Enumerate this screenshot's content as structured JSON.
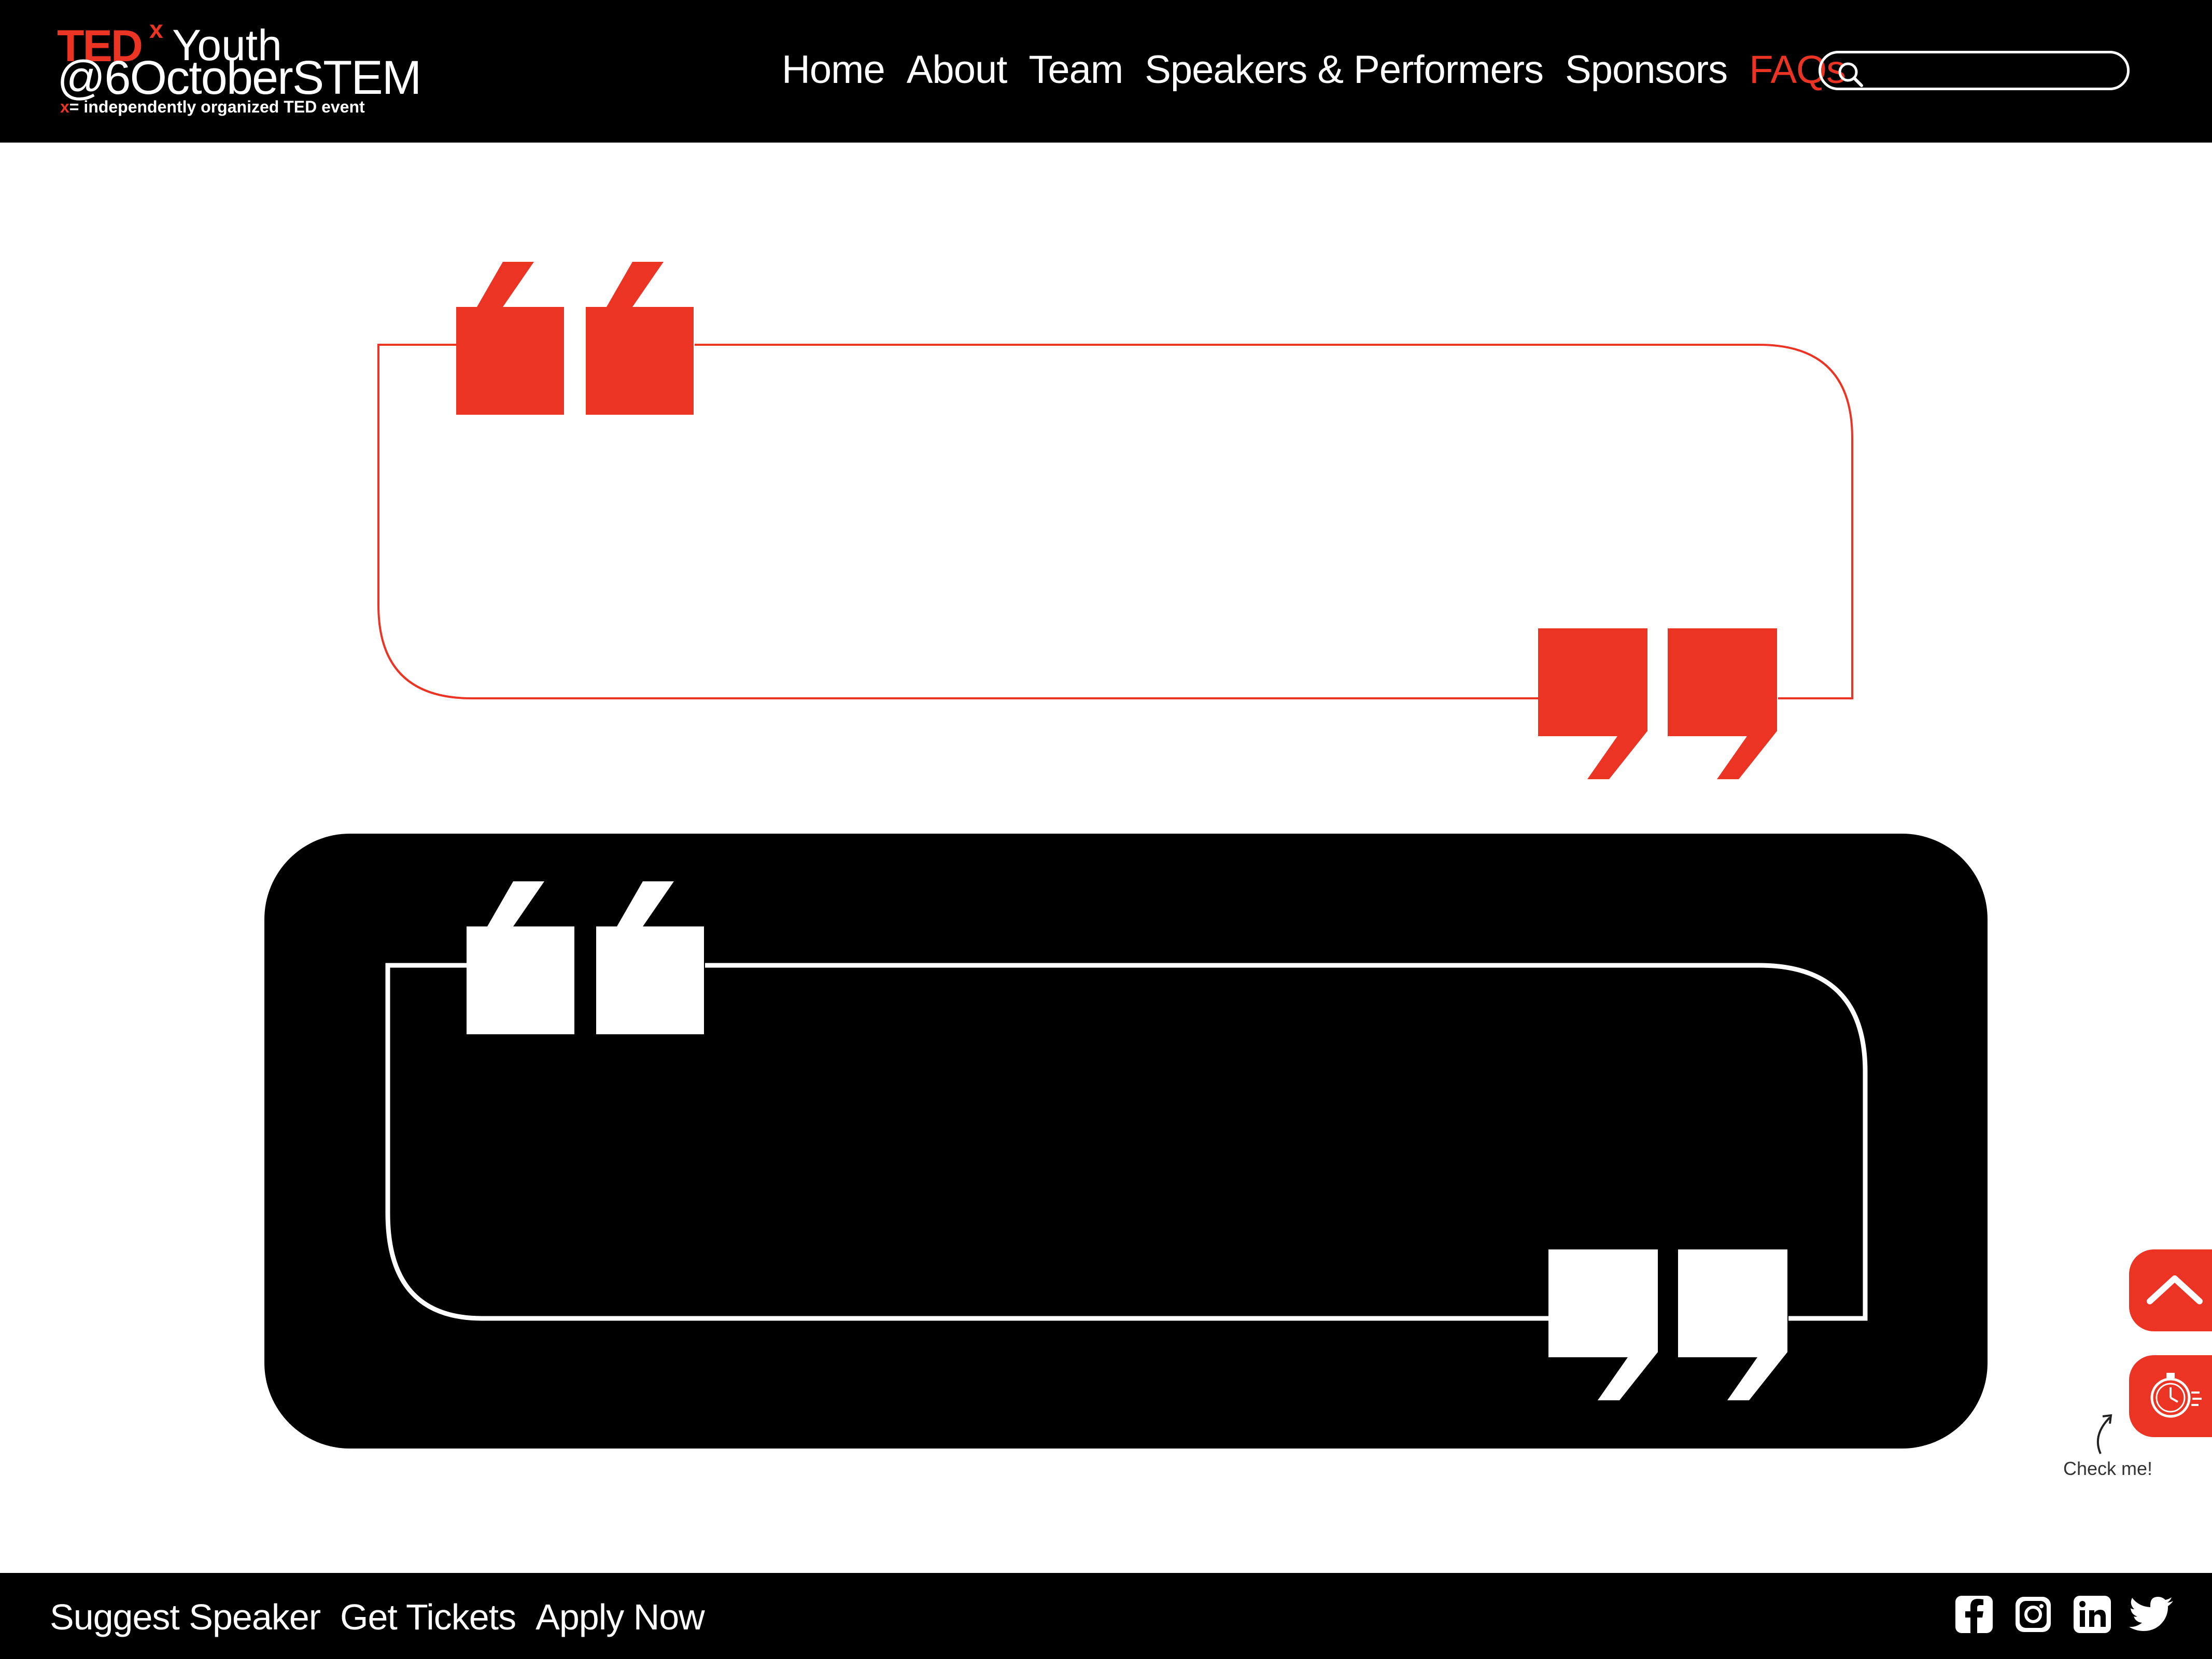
{
  "brand": {
    "ted": "TED",
    "x": "x",
    "youth": "Youth",
    "event_name": "@6OctoberSTEM",
    "tagline_x": "x",
    "tagline": "= independently organized TED event"
  },
  "nav": {
    "items": [
      {
        "label": "Home"
      },
      {
        "label": "About"
      },
      {
        "label": "Team"
      },
      {
        "label": "Speakers & Performers"
      },
      {
        "label": "Sponsors"
      },
      {
        "label": "FAQs",
        "active": true
      }
    ]
  },
  "search": {
    "placeholder": "",
    "icon": "search-icon"
  },
  "floating": {
    "up_icon": "chevron-up-icon",
    "timer_icon": "stopwatch-icon",
    "check_label": "Check me!"
  },
  "footer": {
    "links": [
      {
        "label": "Suggest Speaker"
      },
      {
        "label": "Get Tickets"
      },
      {
        "label": "Apply Now"
      }
    ],
    "social": [
      "facebook-icon",
      "instagram-icon",
      "linkedin-icon",
      "twitter-icon"
    ]
  },
  "colors": {
    "accent": "#eb3424",
    "header_bg": "#000000",
    "page_bg": "#ffffff"
  }
}
